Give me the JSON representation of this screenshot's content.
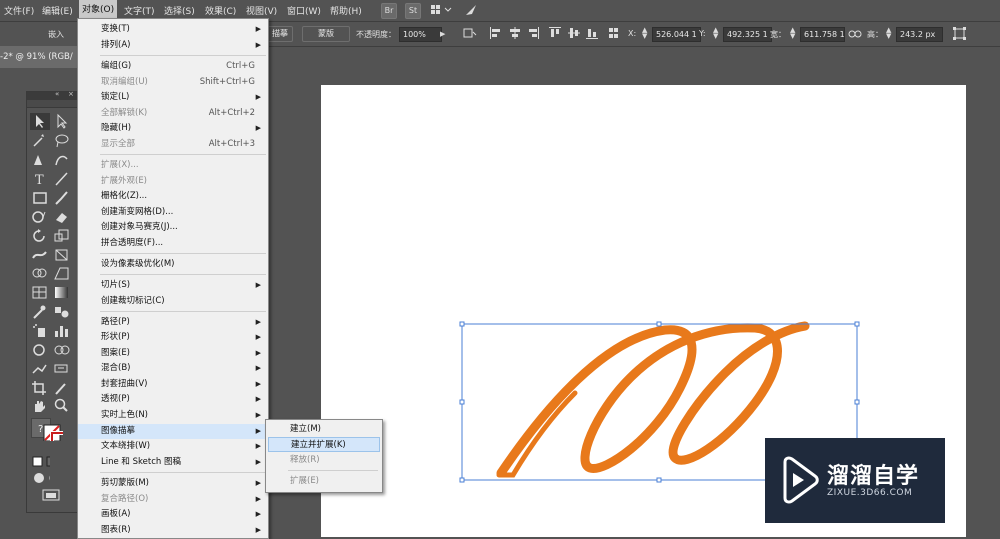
{
  "menubar": {
    "items": [
      "文件(F)",
      "编辑(E)",
      "对象(O)",
      "文字(T)",
      "选择(S)",
      "效果(C)",
      "视图(V)",
      "窗口(W)",
      "帮助(H)"
    ],
    "bridge": "Br",
    "stock": "St"
  },
  "control": {
    "embed": "嵌入",
    "trace": "描摹",
    "mask": "蒙版",
    "opacity_label": "不透明度：",
    "opacity_value": "100%",
    "x_label": "X:",
    "x_value": "526.044 1",
    "y_label": "Y:",
    "y_value": "492.325 1",
    "w_label": "宽：",
    "w_value": "611.758 1",
    "h_label": "高：",
    "h_value": "243.2 px"
  },
  "document_tab": "-2* @ 91% (RGB/",
  "object_menu": [
    {
      "label": "变换(T)",
      "shortcut": "",
      "submenu": true,
      "disabled": false
    },
    {
      "label": "排列(A)",
      "shortcut": "",
      "submenu": true,
      "disabled": false
    },
    {
      "label": "编组(G)",
      "shortcut": "Ctrl+G",
      "submenu": false,
      "disabled": false
    },
    {
      "label": "取消编组(U)",
      "shortcut": "Shift+Ctrl+G",
      "submenu": false,
      "disabled": true
    },
    {
      "label": "锁定(L)",
      "shortcut": "",
      "submenu": true,
      "disabled": false
    },
    {
      "label": "全部解锁(K)",
      "shortcut": "Alt+Ctrl+2",
      "submenu": false,
      "disabled": true
    },
    {
      "label": "隐藏(H)",
      "shortcut": "",
      "submenu": true,
      "disabled": false
    },
    {
      "label": "显示全部",
      "shortcut": "Alt+Ctrl+3",
      "submenu": false,
      "disabled": true
    },
    {
      "label": "扩展(X)...",
      "shortcut": "",
      "submenu": false,
      "disabled": true
    },
    {
      "label": "扩展外观(E)",
      "shortcut": "",
      "submenu": false,
      "disabled": true
    },
    {
      "label": "栅格化(Z)...",
      "shortcut": "",
      "submenu": false,
      "disabled": false
    },
    {
      "label": "创建渐变网格(D)...",
      "shortcut": "",
      "submenu": false,
      "disabled": false
    },
    {
      "label": "创建对象马赛克(J)...",
      "shortcut": "",
      "submenu": false,
      "disabled": false
    },
    {
      "label": "拼合透明度(F)...",
      "shortcut": "",
      "submenu": false,
      "disabled": false
    },
    {
      "label": "设为像素级优化(M)",
      "shortcut": "",
      "submenu": false,
      "disabled": false
    },
    {
      "label": "切片(S)",
      "shortcut": "",
      "submenu": true,
      "disabled": false
    },
    {
      "label": "创建裁切标记(C)",
      "shortcut": "",
      "submenu": false,
      "disabled": false
    },
    {
      "label": "路径(P)",
      "shortcut": "",
      "submenu": true,
      "disabled": false
    },
    {
      "label": "形状(P)",
      "shortcut": "",
      "submenu": true,
      "disabled": false
    },
    {
      "label": "图案(E)",
      "shortcut": "",
      "submenu": true,
      "disabled": false
    },
    {
      "label": "混合(B)",
      "shortcut": "",
      "submenu": true,
      "disabled": false
    },
    {
      "label": "封套扭曲(V)",
      "shortcut": "",
      "submenu": true,
      "disabled": false
    },
    {
      "label": "透视(P)",
      "shortcut": "",
      "submenu": true,
      "disabled": false
    },
    {
      "label": "实时上色(N)",
      "shortcut": "",
      "submenu": true,
      "disabled": false
    },
    {
      "label": "图像描摹",
      "shortcut": "",
      "submenu": true,
      "disabled": false,
      "highlighted": true
    },
    {
      "label": "文本绕排(W)",
      "shortcut": "",
      "submenu": true,
      "disabled": false
    },
    {
      "label": "Line 和 Sketch 图稿",
      "shortcut": "",
      "submenu": true,
      "disabled": false
    },
    {
      "label": "剪切蒙版(M)",
      "shortcut": "",
      "submenu": true,
      "disabled": false
    },
    {
      "label": "复合路径(O)",
      "shortcut": "",
      "submenu": true,
      "disabled": true
    },
    {
      "label": "画板(A)",
      "shortcut": "",
      "submenu": true,
      "disabled": false
    },
    {
      "label": "图表(R)",
      "shortcut": "",
      "submenu": true,
      "disabled": false
    }
  ],
  "trace_submenu": [
    {
      "label": "建立(M)",
      "disabled": false
    },
    {
      "label": "建立并扩展(K)",
      "disabled": false,
      "highlighted": true
    },
    {
      "label": "释放(R)",
      "disabled": true
    },
    {
      "label": "扩展(E)",
      "disabled": true
    }
  ],
  "artwork": {
    "stroke_color": "#e8791b",
    "selection_color": "#4a7fd6"
  },
  "watermark": {
    "title": "溜溜自学",
    "url": "ZIXUE.3D66.COM"
  }
}
